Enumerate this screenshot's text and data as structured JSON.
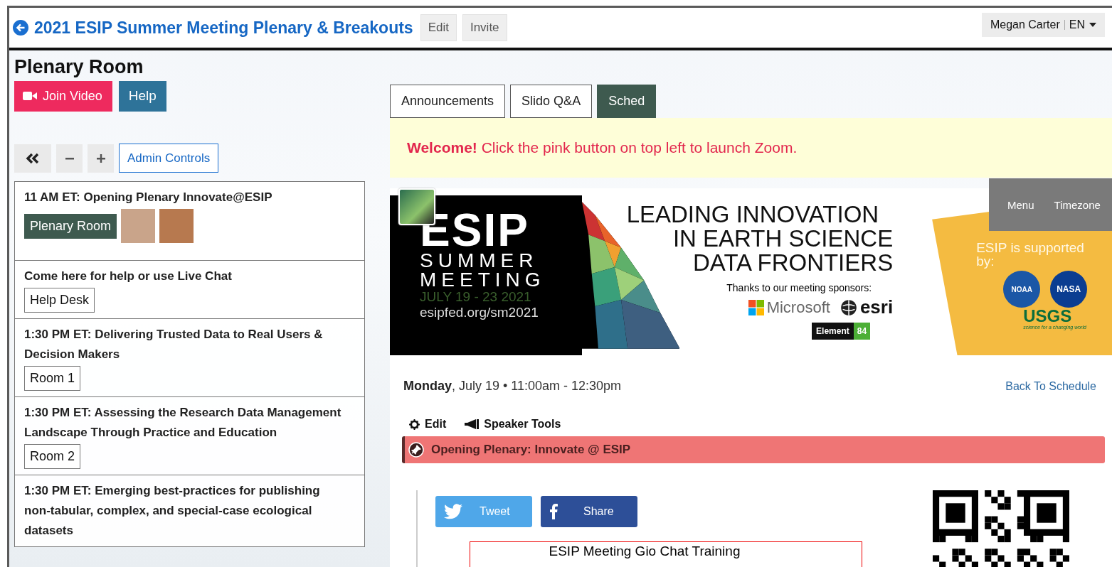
{
  "header": {
    "title": "2021 ESIP Summer Meeting Plenary & Breakouts",
    "buttons": [
      "Edit",
      "Invite"
    ],
    "user": "Megan Carter",
    "language": "EN"
  },
  "room": {
    "title": "Plenary Room",
    "join": "Join Video",
    "help": "Help"
  },
  "controls": {
    "admin": "Admin Controls"
  },
  "sessions": [
    {
      "title": "11 AM ET: Opening Plenary Innovate@ESIP",
      "room": "Plenary Room",
      "selected": true,
      "avatars": [
        {
          "kind": "photo"
        },
        {
          "kind": "photo"
        }
      ]
    },
    {
      "title": "Come here for help or use Live Chat",
      "room": "Help Desk",
      "selected": false
    },
    {
      "title": "1:30 PM ET: Delivering Trusted Data to Real Users & Decision Makers",
      "room": "Room 1",
      "selected": false
    },
    {
      "title": "1:30 PM ET: Assessing the Research Data Management Landscape Through Practice and Education",
      "room": "Room 2",
      "selected": false
    },
    {
      "title": "1:30 PM ET: Emerging best-practices for publishing non-tabular, complex, and special-case ecological datasets"
    }
  ],
  "tabs": [
    {
      "label": "Announcements",
      "selected": false
    },
    {
      "label": "Slido Q&A",
      "selected": false
    },
    {
      "label": "Sched",
      "selected": true
    }
  ],
  "notice": "**Welcome!** Click the pink button on top left to launch Zoom.",
  "banner": {
    "logo": "ESIP",
    "line1": "SUMMER",
    "line2": "MEETING",
    "dates": "JULY 19 - 23 2021",
    "url": "esipfed.org/sm2021",
    "headline": [
      "LEADING INNOVATION",
      "IN EARTH SCIENCE",
      "DATA FRONTIERS"
    ],
    "thanks": "Thanks to our meeting sponsors:",
    "sponsors": [
      "Microsoft",
      "esri"
    ],
    "element": [
      "Element",
      "84"
    ],
    "supported": "ESIP is supported by:",
    "agencies": [
      "NOAA",
      "NASA"
    ],
    "usgs": "USGS",
    "usgs_tag": "science for a changing world"
  },
  "sched_nav": [
    "Menu",
    "Timezone"
  ],
  "event": {
    "date": "**Monday**, July 19 • 11:00am - 12:30pm",
    "back": "Back To Schedule",
    "tools": [
      {
        "kind": "gear",
        "label": "Edit"
      },
      {
        "kind": "megaphone",
        "label": "Speaker Tools"
      }
    ],
    "title": "Opening Plenary: Innovate @ ESIP",
    "share": [
      {
        "kind": "twitter",
        "label": "Tweet"
      },
      {
        "kind": "facebook",
        "label": "Share"
      }
    ],
    "document": "ESIP Meeting Gio Chat Training"
  }
}
